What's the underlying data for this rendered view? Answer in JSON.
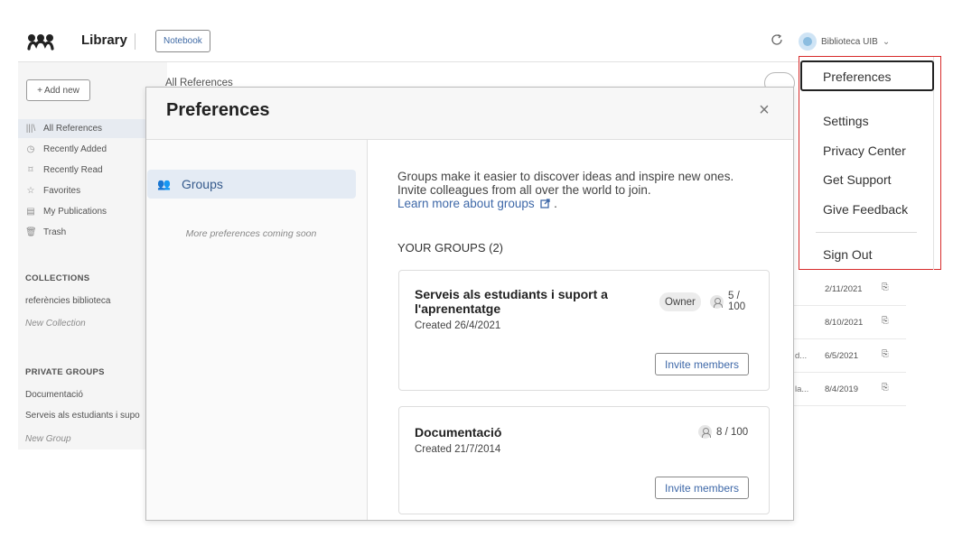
{
  "topbar": {
    "title": "Library",
    "notebook_label": "Notebook",
    "account_name": "Biblioteca UIB",
    "chevron": "⌄"
  },
  "sidebar": {
    "add_new_label": "Add new",
    "items": [
      {
        "label": "All References",
        "icon": "library-icon",
        "glyph": "|||\\"
      },
      {
        "label": "Recently Added",
        "icon": "clock-icon",
        "glyph": "◷"
      },
      {
        "label": "Recently Read",
        "icon": "bookmark-icon",
        "glyph": "⌑"
      },
      {
        "label": "Favorites",
        "icon": "star-icon",
        "glyph": "☆"
      },
      {
        "label": "My Publications",
        "icon": "document-icon",
        "glyph": "▤"
      },
      {
        "label": "Trash",
        "icon": "trash-icon",
        "glyph": "🗑"
      }
    ],
    "collections_heading": "COLLECTIONS",
    "collections": [
      "referències biblioteca"
    ],
    "new_collection": "New Collection",
    "private_groups_heading": "PRIVATE GROUPS",
    "private_groups": [
      "Documentació",
      "Serveis als estudiants i supo"
    ],
    "new_group": "New Group"
  },
  "background_list": {
    "header": "All References",
    "rows": [
      {
        "frag": "",
        "date": "2/11/2021"
      },
      {
        "frag": "",
        "date": "8/10/2021"
      },
      {
        "frag": "d...",
        "date": "6/5/2021"
      },
      {
        "frag": "la...",
        "date": "8/4/2019"
      }
    ]
  },
  "preferences": {
    "title": "Preferences",
    "close_glyph": "×",
    "groups_tab": "Groups",
    "coming_soon": "More preferences coming soon",
    "intro_line1": "Groups make it easier to discover ideas and inspire new ones.",
    "intro_line2": "Invite colleagues from all over the world to join.",
    "learn_more": "Learn more about groups",
    "your_groups": "YOUR GROUPS (2)",
    "groups": [
      {
        "name": "Serveis als estudiants i suport a l'aprenentatge",
        "created": "Created 26/4/2021",
        "role": "Owner",
        "members": "5 / 100",
        "invite": "Invite members"
      },
      {
        "name": "Documentació",
        "created": "Created 21/7/2014",
        "members": "8 / 100",
        "invite": "Invite members"
      }
    ]
  },
  "account_menu": {
    "items": [
      "Preferences",
      "Settings",
      "Privacy Center",
      "Get Support",
      "Give Feedback",
      "Sign Out"
    ]
  },
  "colors": {
    "accent": "#3e68a8",
    "menu_highlight_border": "#d72b2b"
  }
}
